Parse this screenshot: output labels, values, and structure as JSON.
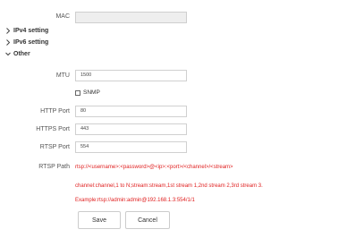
{
  "mac": {
    "label": "MAC",
    "value": ""
  },
  "sections": {
    "ipv4": "IPv4 setting",
    "ipv6": "IPv6 setting",
    "other": "Other"
  },
  "mtu": {
    "label": "MTU",
    "value": "1500"
  },
  "snmp": {
    "label": "SNMP",
    "checked": false
  },
  "http_port": {
    "label": "HTTP Port",
    "value": "80"
  },
  "https_port": {
    "label": "HTTPS Port",
    "value": "443"
  },
  "rtsp_port": {
    "label": "RTSP Port",
    "value": "554"
  },
  "rtsp_path": {
    "label": "RTSP Path",
    "format": "rtsp://<username>:<password>@<ip>:<port>/<channel>/<stream>",
    "channel_note": "channel:channel,1 to N;stream:stream,1st stream 1,2nd stream 2,3rd stream 3.",
    "example": "Example:rtsp://admin:admin@192.168.1.3:554/1/1"
  },
  "buttons": {
    "save": "Save",
    "cancel": "Cancel"
  },
  "colors": {
    "note_red": "#e02020",
    "field_border": "#d0d0d0"
  },
  "icons": {
    "collapsed": "chevron-right-icon",
    "expanded": "chevron-down-icon"
  }
}
